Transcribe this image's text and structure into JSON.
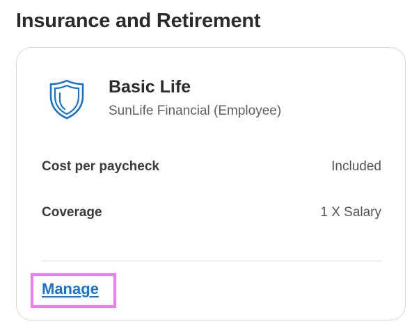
{
  "section": {
    "title": "Insurance and Retirement"
  },
  "plan": {
    "icon": "shield-icon",
    "name": "Basic Life",
    "provider": "SunLife Financial (Employee)",
    "details": [
      {
        "label": "Cost per paycheck",
        "value": "Included"
      },
      {
        "label": "Coverage",
        "value": "1 X Salary"
      }
    ],
    "manage_label": "Manage"
  },
  "colors": {
    "accent": "#1a73c8",
    "highlight": "#f07cf0"
  }
}
